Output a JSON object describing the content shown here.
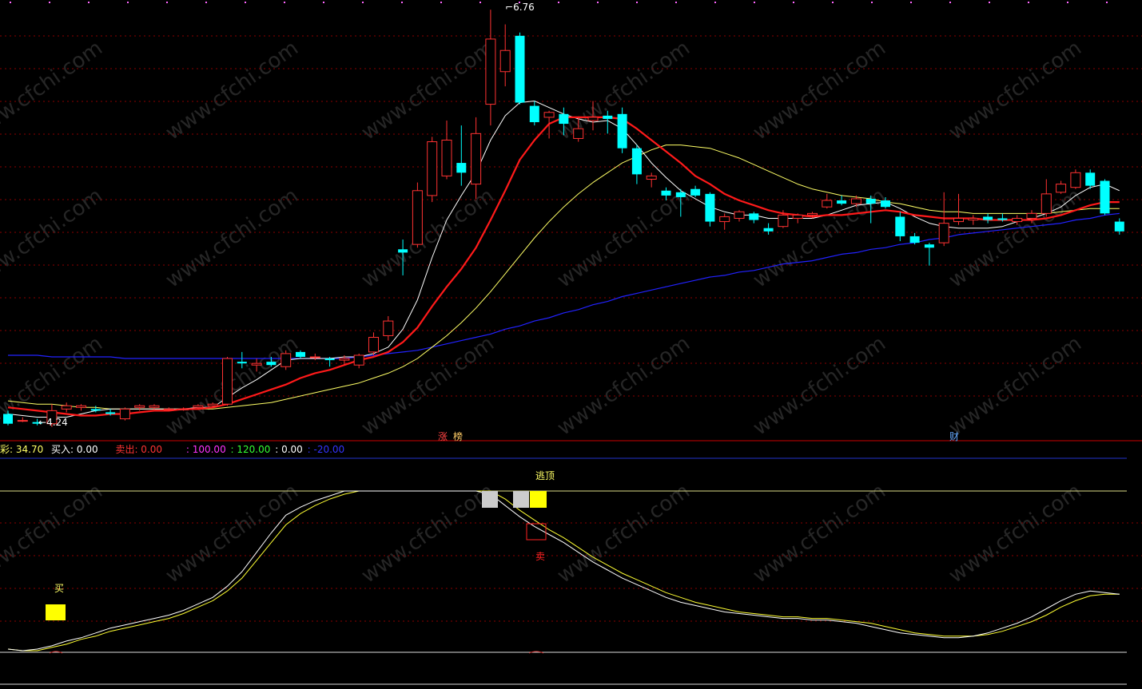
{
  "colors": {
    "background": "#000000",
    "up": "#ff3232",
    "down": "#00ffff",
    "ma5": "#ffffff",
    "ma10": "#ff1a1a",
    "ma20": "#ffff66",
    "ma60": "#2222ff",
    "grid": "#8b0000",
    "divider": "#cc0000",
    "osc_fast": "#ffffff",
    "osc_slow": "#ffff33",
    "buy_signal": "#ffff00",
    "sell_signal": "#ff2222"
  },
  "price_panel": {
    "high_label": "6.76",
    "low_label": "4.24",
    "markers": [
      {
        "text": "涨",
        "candle": 30,
        "color": "#ff4444"
      },
      {
        "text": "榜",
        "candle": 31,
        "color": "#ffcc66"
      },
      {
        "text": "财",
        "candle": 66,
        "color": "#66aaff"
      }
    ]
  },
  "status_bar": {
    "items": [
      {
        "text": "彩: 34.70",
        "color": "#ffff66"
      },
      {
        "text": "买入: 0.00",
        "color": "#ffffff"
      },
      {
        "text": "卖出: 0.00",
        "color": "#ff3333"
      },
      {
        "text": ": 100.00",
        "color": "#ff33ff"
      },
      {
        "text": ": 120.00",
        "color": "#33ff33"
      },
      {
        "text": ": 0.00",
        "color": "#ffffff"
      },
      {
        "text": ": -20.00",
        "color": "#3333ff"
      }
    ]
  },
  "indicator_panel": {
    "top_signal_label": "逃顶",
    "buy_label": "买",
    "sell_label": "卖"
  },
  "chart_data": {
    "type": "candlestick",
    "ylim": [
      4.15,
      6.8
    ],
    "candles": [
      {
        "o": 4.28,
        "h": 4.3,
        "l": 4.21,
        "c": 4.22
      },
      {
        "o": 4.24,
        "h": 4.26,
        "l": 4.23,
        "c": 4.24
      },
      {
        "o": 4.23,
        "h": 4.25,
        "l": 4.21,
        "c": 4.22
      },
      {
        "o": 4.22,
        "h": 4.34,
        "l": 4.2,
        "c": 4.3
      },
      {
        "o": 4.31,
        "h": 4.35,
        "l": 4.29,
        "c": 4.33
      },
      {
        "o": 4.32,
        "h": 4.34,
        "l": 4.3,
        "c": 4.33
      },
      {
        "o": 4.31,
        "h": 4.33,
        "l": 4.29,
        "c": 4.3
      },
      {
        "o": 4.29,
        "h": 4.31,
        "l": 4.27,
        "c": 4.28
      },
      {
        "o": 4.25,
        "h": 4.32,
        "l": 4.24,
        "c": 4.31
      },
      {
        "o": 4.32,
        "h": 4.34,
        "l": 4.3,
        "c": 4.33
      },
      {
        "o": 4.32,
        "h": 4.34,
        "l": 4.31,
        "c": 4.33
      },
      {
        "o": 4.31,
        "h": 4.32,
        "l": 4.3,
        "c": 4.31
      },
      {
        "o": 4.31,
        "h": 4.32,
        "l": 4.3,
        "c": 4.31
      },
      {
        "o": 4.32,
        "h": 4.34,
        "l": 4.31,
        "c": 4.33
      },
      {
        "o": 4.33,
        "h": 4.35,
        "l": 4.32,
        "c": 4.34
      },
      {
        "o": 4.34,
        "h": 4.63,
        "l": 4.33,
        "c": 4.62
      },
      {
        "o": 4.6,
        "h": 4.66,
        "l": 4.56,
        "c": 4.59
      },
      {
        "o": 4.58,
        "h": 4.62,
        "l": 4.54,
        "c": 4.59
      },
      {
        "o": 4.6,
        "h": 4.63,
        "l": 4.57,
        "c": 4.58
      },
      {
        "o": 4.57,
        "h": 4.67,
        "l": 4.55,
        "c": 4.65
      },
      {
        "o": 4.66,
        "h": 4.67,
        "l": 4.62,
        "c": 4.63
      },
      {
        "o": 4.63,
        "h": 4.65,
        "l": 4.61,
        "c": 4.63
      },
      {
        "o": 4.62,
        "h": 4.63,
        "l": 4.57,
        "c": 4.61
      },
      {
        "o": 4.61,
        "h": 4.64,
        "l": 4.58,
        "c": 4.62
      },
      {
        "o": 4.58,
        "h": 4.65,
        "l": 4.56,
        "c": 4.64
      },
      {
        "o": 4.66,
        "h": 4.78,
        "l": 4.64,
        "c": 4.75
      },
      {
        "o": 4.76,
        "h": 4.88,
        "l": 4.73,
        "c": 4.85
      },
      {
        "o": 5.29,
        "h": 5.35,
        "l": 5.13,
        "c": 5.27
      },
      {
        "o": 5.32,
        "h": 5.7,
        "l": 5.3,
        "c": 5.65
      },
      {
        "o": 5.62,
        "h": 5.98,
        "l": 5.58,
        "c": 5.95
      },
      {
        "o": 5.74,
        "h": 6.08,
        "l": 5.72,
        "c": 5.96
      },
      {
        "o": 5.82,
        "h": 6.05,
        "l": 5.68,
        "c": 5.76
      },
      {
        "o": 5.69,
        "h": 6.1,
        "l": 5.6,
        "c": 6.0
      },
      {
        "o": 6.18,
        "h": 6.76,
        "l": 6.05,
        "c": 6.58
      },
      {
        "o": 6.38,
        "h": 6.67,
        "l": 6.29,
        "c": 6.51
      },
      {
        "o": 6.6,
        "h": 6.62,
        "l": 6.18,
        "c": 6.19
      },
      {
        "o": 6.17,
        "h": 6.2,
        "l": 6.05,
        "c": 6.07
      },
      {
        "o": 6.1,
        "h": 6.14,
        "l": 5.97,
        "c": 6.13
      },
      {
        "o": 6.12,
        "h": 6.16,
        "l": 5.99,
        "c": 6.06
      },
      {
        "o": 5.97,
        "h": 6.1,
        "l": 5.95,
        "c": 6.03
      },
      {
        "o": 6.08,
        "h": 6.2,
        "l": 6.02,
        "c": 6.1
      },
      {
        "o": 6.11,
        "h": 6.14,
        "l": 6.0,
        "c": 6.09
      },
      {
        "o": 6.12,
        "h": 6.16,
        "l": 5.88,
        "c": 5.91
      },
      {
        "o": 5.91,
        "h": 5.93,
        "l": 5.69,
        "c": 5.75
      },
      {
        "o": 5.72,
        "h": 5.76,
        "l": 5.67,
        "c": 5.74
      },
      {
        "o": 5.65,
        "h": 5.67,
        "l": 5.59,
        "c": 5.62
      },
      {
        "o": 5.64,
        "h": 5.66,
        "l": 5.49,
        "c": 5.61
      },
      {
        "o": 5.66,
        "h": 5.68,
        "l": 5.61,
        "c": 5.62
      },
      {
        "o": 5.63,
        "h": 5.64,
        "l": 5.43,
        "c": 5.46
      },
      {
        "o": 5.46,
        "h": 5.51,
        "l": 5.41,
        "c": 5.49
      },
      {
        "o": 5.48,
        "h": 5.53,
        "l": 5.46,
        "c": 5.52
      },
      {
        "o": 5.51,
        "h": 5.52,
        "l": 5.45,
        "c": 5.47
      },
      {
        "o": 5.42,
        "h": 5.45,
        "l": 5.38,
        "c": 5.4
      },
      {
        "o": 5.43,
        "h": 5.53,
        "l": 5.42,
        "c": 5.5
      },
      {
        "o": 5.48,
        "h": 5.51,
        "l": 5.45,
        "c": 5.5
      },
      {
        "o": 5.5,
        "h": 5.52,
        "l": 5.48,
        "c": 5.51
      },
      {
        "o": 5.55,
        "h": 5.63,
        "l": 5.54,
        "c": 5.59
      },
      {
        "o": 5.59,
        "h": 5.62,
        "l": 5.56,
        "c": 5.57
      },
      {
        "o": 5.57,
        "h": 5.62,
        "l": 5.55,
        "c": 5.6
      },
      {
        "o": 5.6,
        "h": 5.62,
        "l": 5.45,
        "c": 5.57
      },
      {
        "o": 5.59,
        "h": 5.61,
        "l": 5.54,
        "c": 5.55
      },
      {
        "o": 5.49,
        "h": 5.52,
        "l": 5.34,
        "c": 5.37
      },
      {
        "o": 5.37,
        "h": 5.39,
        "l": 5.32,
        "c": 5.33
      },
      {
        "o": 5.32,
        "h": 5.33,
        "l": 5.19,
        "c": 5.3
      },
      {
        "o": 5.33,
        "h": 5.64,
        "l": 5.31,
        "c": 5.45
      },
      {
        "o": 5.46,
        "h": 5.63,
        "l": 5.44,
        "c": 5.48
      },
      {
        "o": 5.47,
        "h": 5.5,
        "l": 5.44,
        "c": 5.48
      },
      {
        "o": 5.49,
        "h": 5.51,
        "l": 5.45,
        "c": 5.47
      },
      {
        "o": 5.48,
        "h": 5.51,
        "l": 5.46,
        "c": 5.47
      },
      {
        "o": 5.46,
        "h": 5.5,
        "l": 5.44,
        "c": 5.48
      },
      {
        "o": 5.48,
        "h": 5.53,
        "l": 5.45,
        "c": 5.51
      },
      {
        "o": 5.51,
        "h": 5.72,
        "l": 5.49,
        "c": 5.63
      },
      {
        "o": 5.64,
        "h": 5.71,
        "l": 5.63,
        "c": 5.69
      },
      {
        "o": 5.67,
        "h": 5.78,
        "l": 5.66,
        "c": 5.76
      },
      {
        "o": 5.76,
        "h": 5.78,
        "l": 5.66,
        "c": 5.68
      },
      {
        "o": 5.71,
        "h": 5.72,
        "l": 5.5,
        "c": 5.51
      },
      {
        "o": 5.46,
        "h": 5.48,
        "l": 5.38,
        "c": 5.4
      }
    ],
    "ma5": [
      4.28,
      4.27,
      4.26,
      4.26,
      4.26,
      4.28,
      4.3,
      4.31,
      4.31,
      4.31,
      4.31,
      4.31,
      4.31,
      4.32,
      4.32,
      4.38,
      4.44,
      4.49,
      4.55,
      4.61,
      4.62,
      4.62,
      4.62,
      4.63,
      4.63,
      4.65,
      4.69,
      4.8,
      4.98,
      5.24,
      5.47,
      5.62,
      5.76,
      5.96,
      6.11,
      6.19,
      6.2,
      6.16,
      6.12,
      6.09,
      6.07,
      6.08,
      6.03,
      5.93,
      5.82,
      5.73,
      5.65,
      5.6,
      5.55,
      5.52,
      5.5,
      5.5,
      5.48,
      5.48,
      5.48,
      5.48,
      5.5,
      5.53,
      5.56,
      5.57,
      5.58,
      5.54,
      5.49,
      5.45,
      5.43,
      5.42,
      5.42,
      5.42,
      5.43,
      5.46,
      5.48,
      5.51,
      5.55,
      5.62,
      5.67,
      5.69,
      5.65
    ],
    "ma10": [
      4.32,
      4.31,
      4.3,
      4.29,
      4.28,
      4.27,
      4.27,
      4.28,
      4.28,
      4.29,
      4.3,
      4.3,
      4.31,
      4.31,
      4.32,
      4.34,
      4.37,
      4.4,
      4.43,
      4.46,
      4.5,
      4.53,
      4.55,
      4.58,
      4.61,
      4.63,
      4.66,
      4.72,
      4.81,
      4.94,
      5.06,
      5.17,
      5.3,
      5.47,
      5.65,
      5.84,
      5.96,
      6.06,
      6.1,
      6.1,
      6.1,
      6.1,
      6.09,
      6.03,
      5.96,
      5.89,
      5.82,
      5.74,
      5.69,
      5.63,
      5.59,
      5.56,
      5.53,
      5.51,
      5.5,
      5.49,
      5.5,
      5.5,
      5.51,
      5.52,
      5.53,
      5.52,
      5.5,
      5.49,
      5.48,
      5.48,
      5.48,
      5.47,
      5.47,
      5.47,
      5.47,
      5.48,
      5.5,
      5.53,
      5.56,
      5.58,
      5.58
    ],
    "ma20": [
      4.36,
      4.35,
      4.34,
      4.34,
      4.33,
      4.32,
      4.32,
      4.31,
      4.31,
      4.31,
      4.31,
      4.31,
      4.31,
      4.31,
      4.31,
      4.32,
      4.33,
      4.34,
      4.35,
      4.37,
      4.39,
      4.41,
      4.43,
      4.45,
      4.47,
      4.5,
      4.53,
      4.57,
      4.62,
      4.69,
      4.76,
      4.84,
      4.93,
      5.03,
      5.14,
      5.25,
      5.36,
      5.46,
      5.55,
      5.63,
      5.7,
      5.76,
      5.82,
      5.86,
      5.9,
      5.93,
      5.93,
      5.92,
      5.91,
      5.88,
      5.85,
      5.81,
      5.77,
      5.73,
      5.69,
      5.66,
      5.64,
      5.62,
      5.61,
      5.6,
      5.58,
      5.57,
      5.55,
      5.53,
      5.52,
      5.52,
      5.51,
      5.51,
      5.51,
      5.51,
      5.51,
      5.51,
      5.52,
      5.53,
      5.54,
      5.54,
      5.54
    ],
    "ma60": [
      4.64,
      4.64,
      4.64,
      4.63,
      4.63,
      4.63,
      4.63,
      4.63,
      4.62,
      4.62,
      4.62,
      4.62,
      4.62,
      4.62,
      4.62,
      4.62,
      4.62,
      4.62,
      4.62,
      4.62,
      4.62,
      4.62,
      4.62,
      4.62,
      4.63,
      4.64,
      4.65,
      4.66,
      4.67,
      4.69,
      4.71,
      4.73,
      4.75,
      4.77,
      4.8,
      4.82,
      4.85,
      4.87,
      4.9,
      4.92,
      4.95,
      4.97,
      5.0,
      5.02,
      5.04,
      5.06,
      5.08,
      5.1,
      5.12,
      5.13,
      5.15,
      5.16,
      5.18,
      5.2,
      5.21,
      5.22,
      5.24,
      5.26,
      5.27,
      5.29,
      5.3,
      5.32,
      5.33,
      5.35,
      5.36,
      5.38,
      5.39,
      5.4,
      5.41,
      5.42,
      5.43,
      5.44,
      5.45,
      5.47,
      5.48,
      5.5,
      5.51
    ],
    "oscillator": {
      "ylim": [
        -20,
        120
      ],
      "fast": [
        2,
        1,
        2,
        4,
        7,
        9,
        12,
        15,
        17,
        19,
        21,
        23,
        26,
        30,
        34,
        41,
        50,
        62,
        74,
        85,
        90,
        94,
        97,
        100,
        103,
        105,
        107,
        108,
        109,
        110,
        110,
        108,
        104,
        98,
        91,
        84,
        78,
        73,
        68,
        62,
        56,
        51,
        46,
        42,
        38,
        34,
        31,
        29,
        27,
        25,
        24,
        23,
        22,
        21,
        21,
        20,
        20,
        19,
        18,
        16,
        14,
        12,
        11,
        10,
        9,
        9,
        10,
        12,
        15,
        18,
        22,
        27,
        32,
        36,
        38,
        37,
        36
      ],
      "slow": [
        2,
        1,
        1,
        3,
        5,
        8,
        10,
        13,
        15,
        17,
        19,
        21,
        24,
        28,
        32,
        38,
        46,
        57,
        68,
        79,
        86,
        91,
        95,
        98,
        101,
        103,
        105,
        107,
        108,
        109,
        110,
        109,
        106,
        101,
        95,
        88,
        82,
        76,
        71,
        65,
        59,
        54,
        49,
        45,
        41,
        37,
        34,
        31,
        29,
        27,
        25,
        24,
        23,
        22,
        22,
        21,
        21,
        20,
        19,
        18,
        16,
        14,
        12,
        11,
        10,
        10,
        10,
        11,
        13,
        16,
        19,
        23,
        28,
        32,
        35,
        36,
        36
      ]
    }
  }
}
